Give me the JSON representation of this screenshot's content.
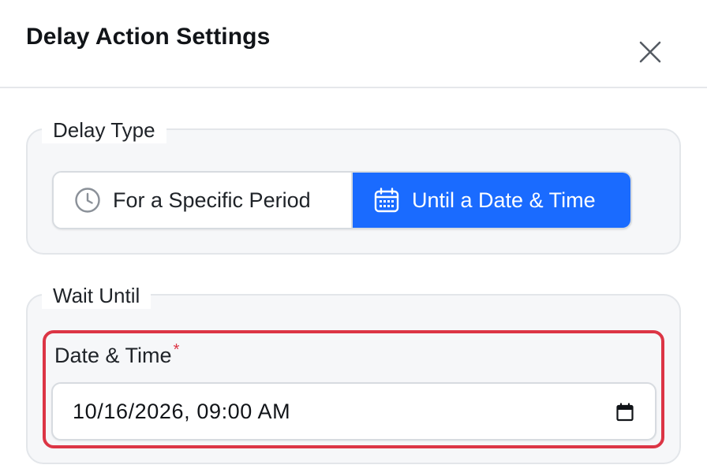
{
  "header": {
    "title": "Delay Action Settings",
    "close_icon": "close-icon"
  },
  "delay_type": {
    "legend": "Delay Type",
    "options": [
      {
        "label": "For a Specific Period",
        "icon": "clock-icon",
        "selected": false
      },
      {
        "label": "Until a Date & Time",
        "icon": "calendar-icon",
        "selected": true
      }
    ],
    "selected_color": "#1a6bff"
  },
  "wait_until": {
    "legend": "Wait Until",
    "field_label": "Date & Time",
    "required_mark": "*",
    "value": "10/16/2026, 09:00 AM",
    "picker_icon": "calendar-icon",
    "highlight_color": "#dc3545"
  }
}
